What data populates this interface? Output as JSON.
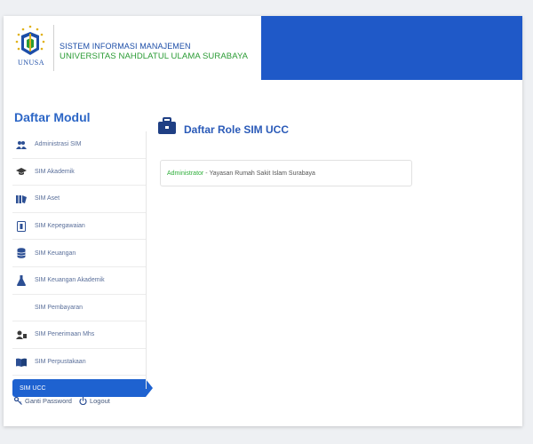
{
  "header": {
    "logo_caption": "UNUSA",
    "title": "SISTEM INFORMASI MANAJEMEN",
    "subtitle": "UNIVERSITAS NAHDLATUL ULAMA SURABAYA"
  },
  "sidebar": {
    "title": "Daftar Modul",
    "items": [
      {
        "label": "Administrasi SIM",
        "icon": "admin-users-icon"
      },
      {
        "label": "SIM Akademik",
        "icon": "graduation-cap-icon"
      },
      {
        "label": "SIM Aset",
        "icon": "assets-icon"
      },
      {
        "label": "SIM Kepegawaian",
        "icon": "id-card-icon"
      },
      {
        "label": "SIM Keuangan",
        "icon": "database-icon"
      },
      {
        "label": "SIM Keuangan Akademik",
        "icon": "flask-icon"
      },
      {
        "label": "SIM Pembayaran",
        "icon": ""
      },
      {
        "label": "SIM Penerimaan Mhs",
        "icon": "register-icon"
      },
      {
        "label": "SIM Perpustakaan",
        "icon": "book-icon"
      },
      {
        "label": "SIM UCC",
        "icon": "",
        "active": true
      }
    ]
  },
  "footer": {
    "change_password": "Ganti Password",
    "logout": "Logout"
  },
  "main": {
    "title": "Daftar Role SIM UCC",
    "roles": [
      {
        "role": "Administrator",
        "separator": "-",
        "organization": "Yayasan Rumah Sakit Islam Surabaya"
      }
    ]
  },
  "colors": {
    "brand_blue": "#1f59c8",
    "active_blue": "#1e62d0",
    "title_blue": "#2c66c6",
    "role_green": "#2eae3a",
    "subtitle_green": "#2a9b34"
  }
}
